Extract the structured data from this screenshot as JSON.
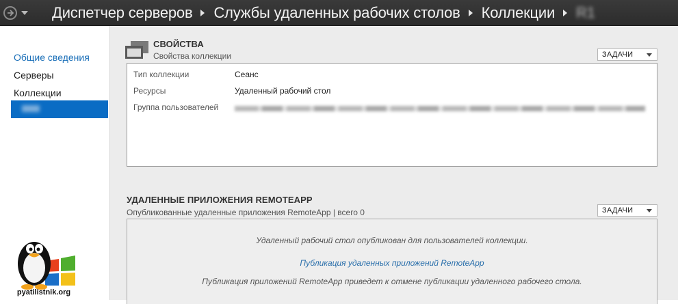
{
  "header": {
    "breadcrumbs": [
      "Диспетчер серверов",
      "Службы удаленных рабочих столов",
      "Коллекции"
    ],
    "last_crumb": "R1"
  },
  "sidebar": {
    "items": [
      {
        "label": "Общие сведения",
        "active": true
      },
      {
        "label": "Серверы",
        "active": false
      },
      {
        "label": "Коллекции",
        "active": false
      }
    ],
    "selected_item_label": "",
    "accent": "#0a6cc4"
  },
  "logo": {
    "text": "pyatilistnik.org"
  },
  "properties": {
    "title": "СВОЙСТВА",
    "subtitle": "Свойства коллекции",
    "tasks_label": "ЗАДАЧИ",
    "rows": [
      {
        "label": "Тип коллекции",
        "value": "Сеанс"
      },
      {
        "label": "Ресурсы",
        "value": "Удаленный рабочий стол"
      },
      {
        "label": "Группа пользователей",
        "value": ""
      }
    ]
  },
  "remoteapp": {
    "title": "УДАЛЕННЫЕ ПРИЛОЖЕНИЯ REMOTEAPP",
    "subtitle": "Опубликованные удаленные приложения RemoteApp | всего 0",
    "tasks_label": "ЗАДАЧИ",
    "message": "Удаленный рабочий стол опубликован для пользователей коллекции.",
    "link": "Публикация удаленных приложений RemoteApp",
    "note": "Публикация приложений RemoteApp приведет к отмене публикации удаленного рабочего стола."
  },
  "colors": {
    "link": "#2a6fab",
    "header_bg": "#2f2f2f"
  }
}
